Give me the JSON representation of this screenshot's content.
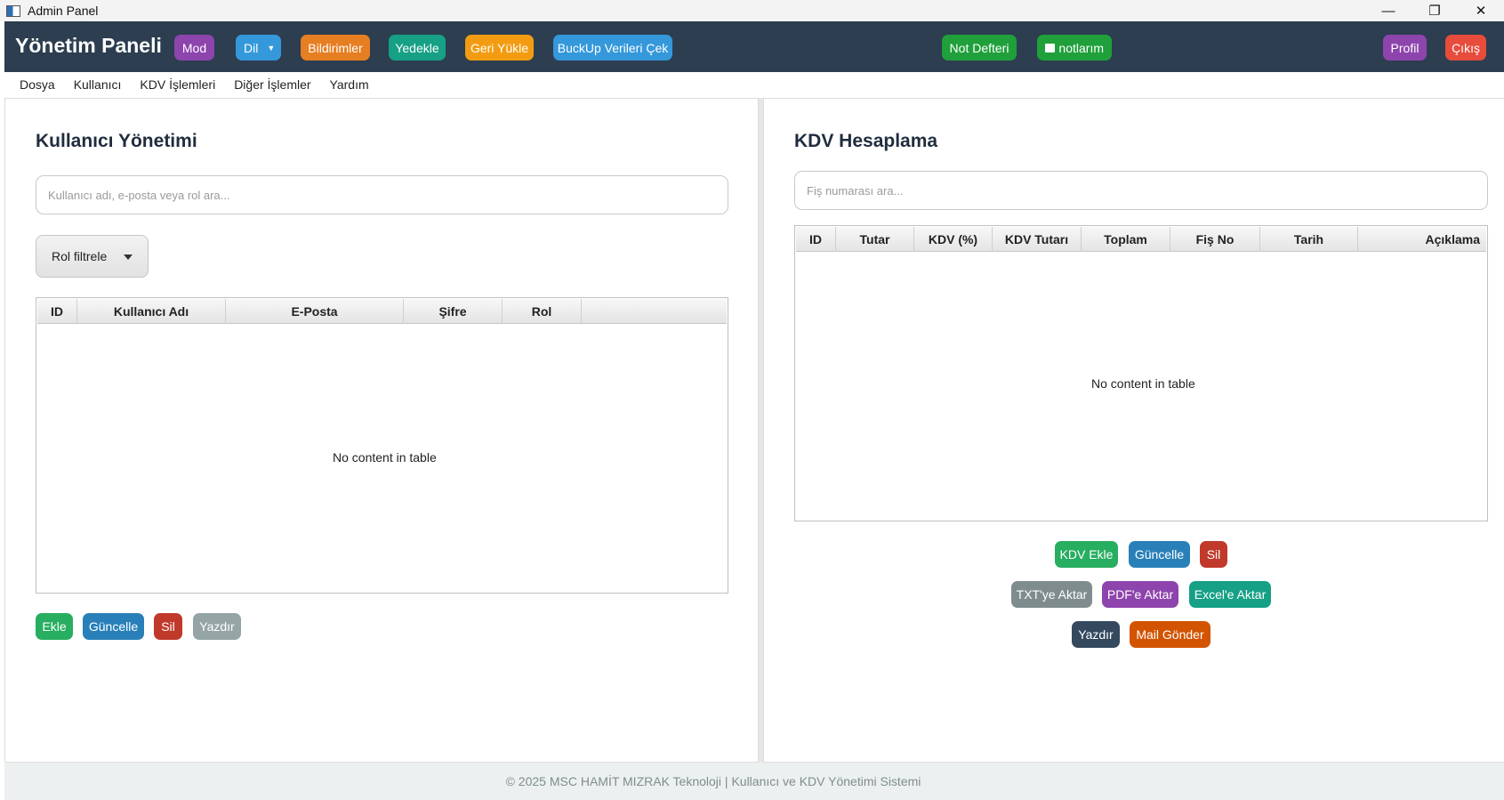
{
  "window": {
    "title": "Admin Panel",
    "controls": {
      "minimize": "—",
      "restore": "❐",
      "close": "✕"
    }
  },
  "header": {
    "title": "Yönetim Paneli",
    "buttons": {
      "mod": "Mod",
      "dil": "Dil",
      "bildirimler": "Bildirimler",
      "yedekle": "Yedekle",
      "geri_yukle": "Geri Yükle",
      "backup_cek": "BuckUp Verileri Çek",
      "not_defteri": "Not Defteri",
      "notlarim": "notlarım",
      "profil": "Profil",
      "cikis": "Çıkış"
    },
    "colors": {
      "bar": "#2c3e50",
      "purple": "#8e44ad",
      "blue": "#3498db",
      "orange": "#f39c12",
      "teal": "#16a085",
      "green": "#1fa03a",
      "red": "#e74c3c"
    }
  },
  "menu": {
    "items": [
      "Dosya",
      "Kullanıcı",
      "KDV İşlemleri",
      "Diğer İşlemler",
      "Yardım"
    ]
  },
  "users": {
    "title": "Kullanıcı Yönetimi",
    "search_placeholder": "Kullanıcı adı, e-posta veya rol ara...",
    "role_filter": "Rol filtrele",
    "columns": [
      "ID",
      "Kullanıcı Adı",
      "E-Posta",
      "Şifre",
      "Rol"
    ],
    "empty_text": "No content in table",
    "actions": {
      "ekle": "Ekle",
      "guncelle": "Güncelle",
      "sil": "Sil",
      "yazdir": "Yazdır"
    }
  },
  "kdv": {
    "title": "KDV Hesaplama",
    "search_placeholder": "Fiş numarası ara...",
    "columns": [
      "ID",
      "Tutar",
      "KDV (%)",
      "KDV Tutarı",
      "Toplam",
      "Fiş No",
      "Tarih",
      "Açıklama"
    ],
    "empty_text": "No content in table",
    "actions": {
      "kdv_ekle": "KDV Ekle",
      "guncelle": "Güncelle",
      "sil": "Sil",
      "txt": "TXT'ye Aktar",
      "pdf": "PDF'e Aktar",
      "excel": "Excel'e Aktar",
      "yazdir": "Yazdır",
      "mail": "Mail Gönder"
    }
  },
  "footer": {
    "text": "© 2025 MSC HAMİT MIZRAK Teknoloji | Kullanıcı ve KDV Yönetimi Sistemi"
  }
}
